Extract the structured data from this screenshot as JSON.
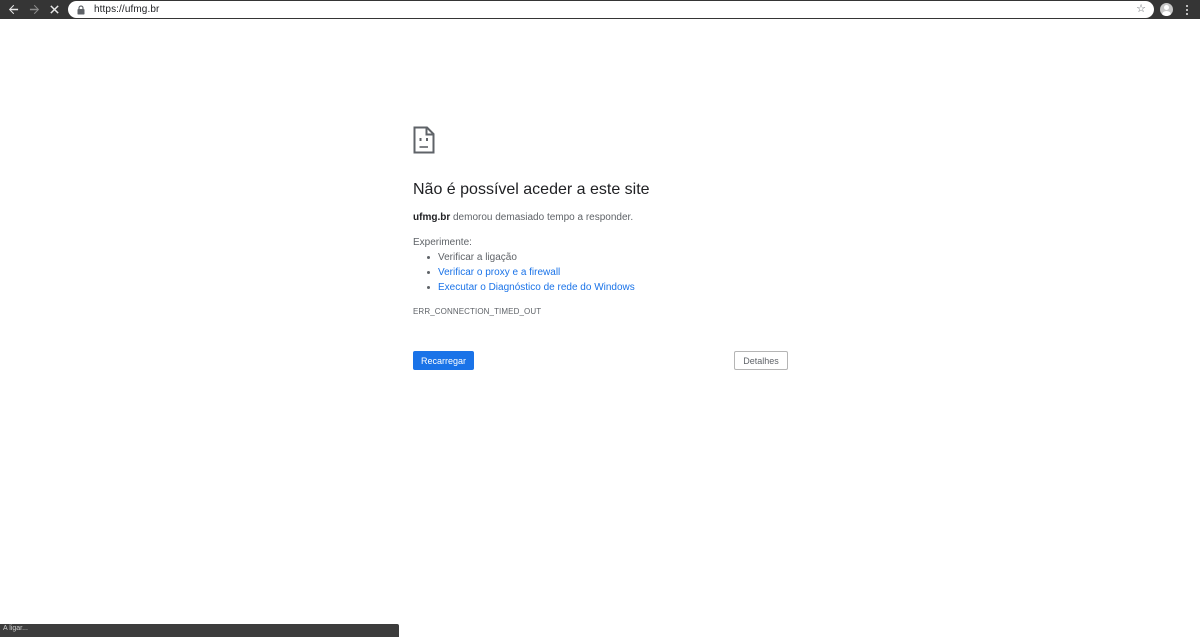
{
  "browser": {
    "back_icon": "arrow-left-icon",
    "forward_icon": "arrow-right-icon",
    "stop_icon": "close-icon",
    "lock_icon": "lock-icon",
    "url": "https://ufmg.br",
    "star_icon": "star-icon",
    "profile_icon": "avatar-icon",
    "menu_icon": "kebab-menu-icon"
  },
  "error_page": {
    "icon": "sad-page-icon",
    "title": "Não é possível aceder a este site",
    "host": "ufmg.br",
    "description": " demorou demasiado tempo a responder.",
    "try_label": "Experimente:",
    "suggestions": [
      {
        "text": "Verificar a ligação",
        "is_link": false
      },
      {
        "text": "Verificar o proxy e a firewall",
        "is_link": true
      },
      {
        "text": "Executar o Diagnóstico de rede do Windows",
        "is_link": true
      }
    ],
    "error_code": "ERR_CONNECTION_TIMED_OUT",
    "reload_label": "Recarregar",
    "details_label": "Detalhes"
  },
  "status_bar": {
    "text": "A ligar..."
  },
  "colors": {
    "toolbar_bg": "#353535",
    "accent": "#1a73e8",
    "link": "#1a73e8",
    "text_primary": "#202124",
    "text_secondary": "#5f6368"
  }
}
